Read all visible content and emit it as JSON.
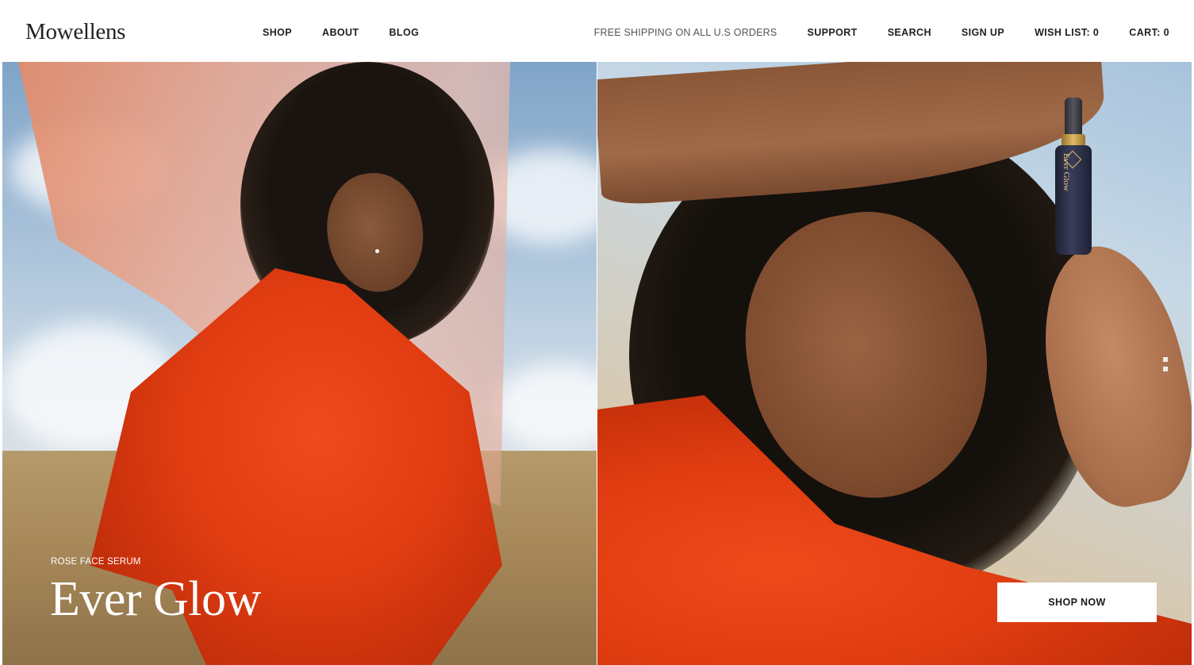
{
  "header": {
    "logo": "Mowellens",
    "nav_left": [
      {
        "label": "SHOP"
      },
      {
        "label": "ABOUT"
      },
      {
        "label": "BLOG"
      }
    ],
    "promo": "FREE SHIPPING ON ALL U.S ORDERS",
    "nav_right": [
      {
        "label": "SUPPORT"
      },
      {
        "label": "SEARCH"
      },
      {
        "label": "SIGN UP"
      },
      {
        "label": "WISH LIST: 0"
      },
      {
        "label": "CART: 0"
      }
    ]
  },
  "hero": {
    "eyebrow": "ROSE FACE SERUM",
    "headline": "Ever Glow",
    "cta_label": "SHOP NOW",
    "product_label": "Ever Glow",
    "images": [
      {
        "name": "model-left-photo",
        "accent": "#e23d12"
      },
      {
        "name": "model-right-photo",
        "accent": "#de3b10"
      }
    ]
  },
  "colors": {
    "background": "#ffffff",
    "text": "#1a1a1a",
    "accent_red": "#e23d12",
    "sky_blue": "#a9c2da"
  }
}
